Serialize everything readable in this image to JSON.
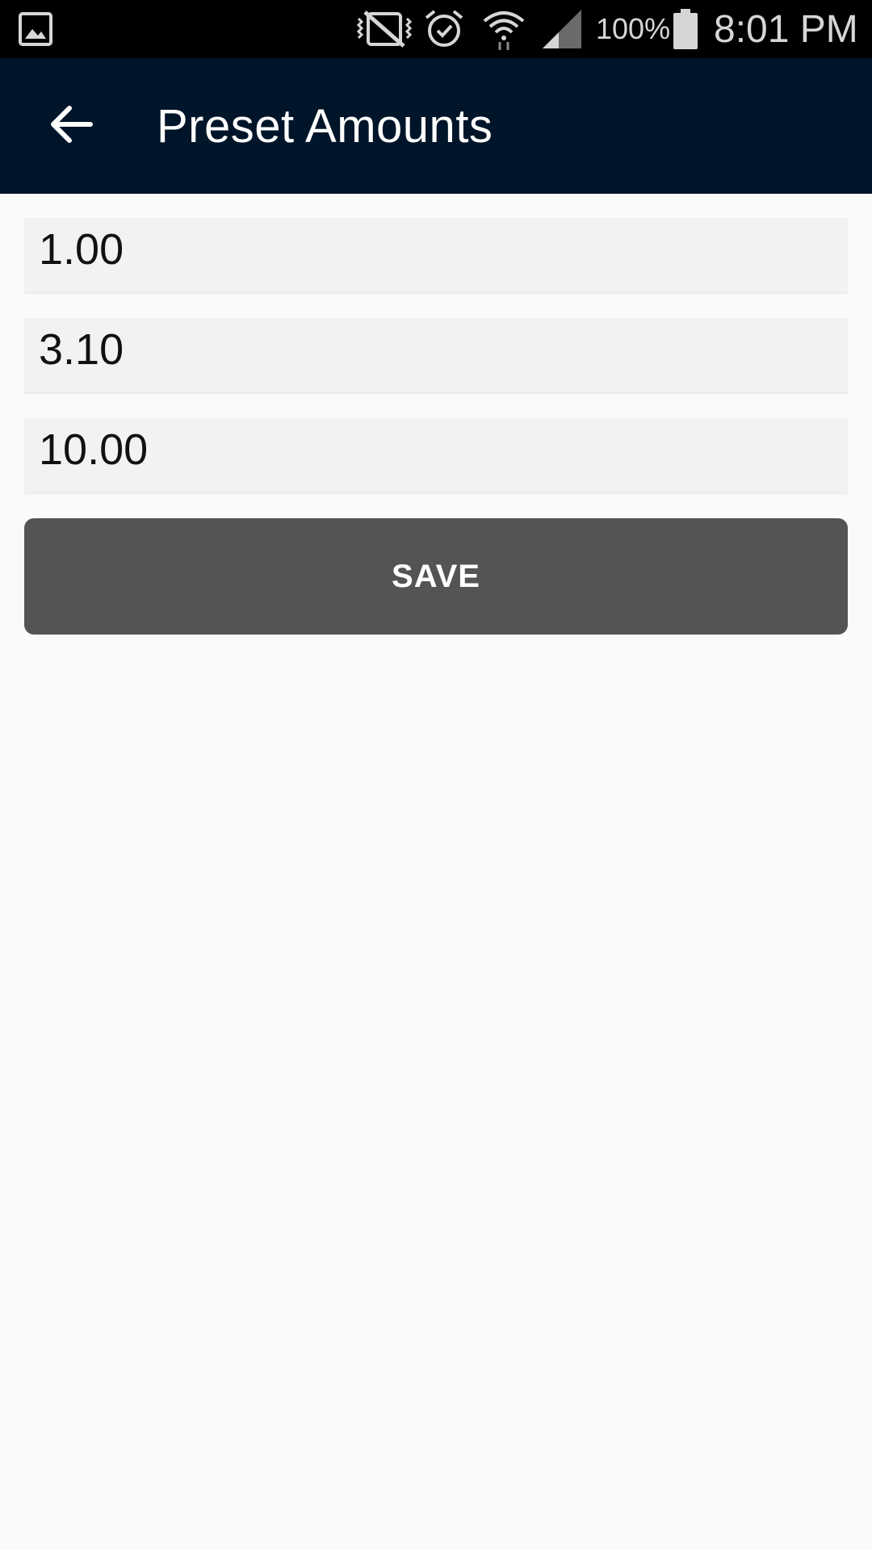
{
  "status_bar": {
    "battery_text": "100%",
    "time": "8:01 PM",
    "icons": [
      "gallery-notification-icon",
      "vibrate-mute-icon",
      "alarm-icon",
      "wifi-icon",
      "cell-signal-icon",
      "battery-icon"
    ]
  },
  "app_bar": {
    "title": "Preset Amounts",
    "back_icon": "arrow-back-icon",
    "background_color": "#001529"
  },
  "presets": [
    {
      "value": "1.00"
    },
    {
      "value": "3.10"
    },
    {
      "value": "10.00"
    }
  ],
  "save_button": {
    "label": "SAVE",
    "color": "#545454"
  }
}
